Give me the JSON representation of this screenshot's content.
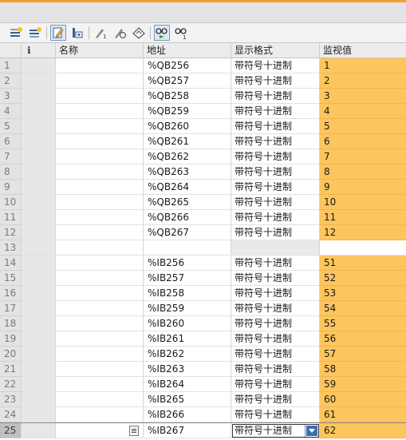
{
  "columns": {
    "info": "ℹ",
    "name": "名称",
    "address": "地址",
    "format": "显示格式",
    "monitor": "监视值"
  },
  "toolbar": {
    "icons": [
      "insert-row-icon",
      "add-row-icon",
      "modify-value-icon",
      "show-all-columns-icon",
      "modify-now-icon",
      "modify-with-trigger-icon",
      "enable-peripheral-icon",
      "monitor-all-icon",
      "monitor-once-icon"
    ]
  },
  "rows": [
    {
      "index": "1",
      "name": "",
      "address": "%QB256",
      "format": "带符号十进制",
      "value": "1"
    },
    {
      "index": "2",
      "name": "",
      "address": "%QB257",
      "format": "带符号十进制",
      "value": "2"
    },
    {
      "index": "3",
      "name": "",
      "address": "%QB258",
      "format": "带符号十进制",
      "value": "3"
    },
    {
      "index": "4",
      "name": "",
      "address": "%QB259",
      "format": "带符号十进制",
      "value": "4"
    },
    {
      "index": "5",
      "name": "",
      "address": "%QB260",
      "format": "带符号十进制",
      "value": "5"
    },
    {
      "index": "6",
      "name": "",
      "address": "%QB261",
      "format": "带符号十进制",
      "value": "6"
    },
    {
      "index": "7",
      "name": "",
      "address": "%QB262",
      "format": "带符号十进制",
      "value": "7"
    },
    {
      "index": "8",
      "name": "",
      "address": "%QB263",
      "format": "带符号十进制",
      "value": "8"
    },
    {
      "index": "9",
      "name": "",
      "address": "%QB264",
      "format": "带符号十进制",
      "value": "9"
    },
    {
      "index": "10",
      "name": "",
      "address": "%QB265",
      "format": "带符号十进制",
      "value": "10"
    },
    {
      "index": "11",
      "name": "",
      "address": "%QB266",
      "format": "带符号十进制",
      "value": "11"
    },
    {
      "index": "12",
      "name": "",
      "address": "%QB267",
      "format": "带符号十进制",
      "value": "12"
    },
    {
      "index": "13",
      "name": "",
      "address": "",
      "format": "",
      "value": ""
    },
    {
      "index": "14",
      "name": "",
      "address": "%IB256",
      "format": "带符号十进制",
      "value": "51"
    },
    {
      "index": "15",
      "name": "",
      "address": "%IB257",
      "format": "带符号十进制",
      "value": "52"
    },
    {
      "index": "16",
      "name": "",
      "address": "%IB258",
      "format": "带符号十进制",
      "value": "53"
    },
    {
      "index": "17",
      "name": "",
      "address": "%IB259",
      "format": "带符号十进制",
      "value": "54"
    },
    {
      "index": "18",
      "name": "",
      "address": "%IB260",
      "format": "带符号十进制",
      "value": "55"
    },
    {
      "index": "19",
      "name": "",
      "address": "%IB261",
      "format": "带符号十进制",
      "value": "56"
    },
    {
      "index": "20",
      "name": "",
      "address": "%IB262",
      "format": "带符号十进制",
      "value": "57"
    },
    {
      "index": "21",
      "name": "",
      "address": "%IB263",
      "format": "带符号十进制",
      "value": "58"
    },
    {
      "index": "22",
      "name": "",
      "address": "%IB264",
      "format": "带符号十进制",
      "value": "59"
    },
    {
      "index": "23",
      "name": "",
      "address": "%IB265",
      "format": "带符号十进制",
      "value": "60"
    },
    {
      "index": "24",
      "name": "",
      "address": "%IB266",
      "format": "带符号十进制",
      "value": "61"
    },
    {
      "index": "25",
      "name": "",
      "address": "%IB267",
      "format": "带符号十进制",
      "value": "62"
    }
  ],
  "colors": {
    "monitor_bg": "#fdc55e",
    "accent_top": "#f0a030",
    "dropdown_button": "#3d6db3"
  }
}
